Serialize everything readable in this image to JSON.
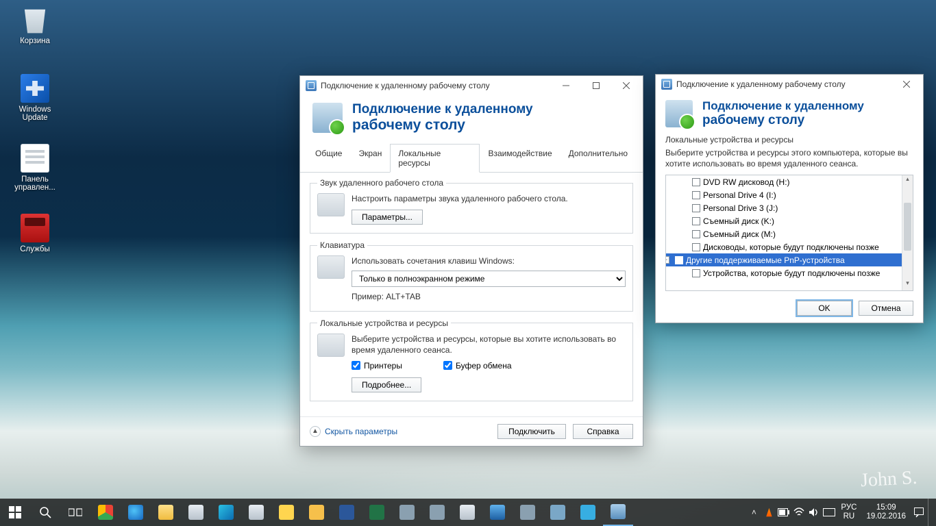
{
  "desktop_icons": {
    "recycle": "Корзина",
    "winupdate": "Windows Update",
    "panel": "Панель управлен...",
    "services": "Службы"
  },
  "win1": {
    "title": "Подключение к удаленному рабочему столу",
    "h1": "Подключение к удаленному",
    "h2": "рабочему столу",
    "tabs": [
      "Общие",
      "Экран",
      "Локальные ресурсы",
      "Взаимодействие",
      "Дополнительно"
    ],
    "fs_audio": {
      "legend": "Звук удаленного рабочего стола",
      "desc": "Настроить параметры звука удаленного рабочего стола.",
      "btn": "Параметры..."
    },
    "fs_kb": {
      "legend": "Клавиатура",
      "desc": "Использовать сочетания клавиш Windows:",
      "option": "Только в полноэкранном режиме",
      "example": "Пример: ALT+TAB"
    },
    "fs_local": {
      "legend": "Локальные устройства и ресурсы",
      "desc": "Выберите устройства и ресурсы, которые вы хотите использовать во время удаленного сеанса.",
      "cb1": "Принтеры",
      "cb2": "Буфер обмена",
      "btn": "Подробнее..."
    },
    "hide_params": "Скрыть параметры",
    "connect": "Подключить",
    "help": "Справка"
  },
  "win2": {
    "title": "Подключение к удаленному рабочему столу",
    "h1": "Подключение к удаленному",
    "h2": "рабочему столу",
    "section": "Локальные устройства и ресурсы",
    "desc": "Выберите устройства и ресурсы этого компьютера, которые вы хотите использовать во время удаленного сеанса.",
    "tree": [
      "DVD RW дисковод (H:)",
      "Personal Drive 4 (I:)",
      "Personal Drive 3 (J:)",
      "Съемный диск (K:)",
      "Съемный диск (M:)",
      "Дисководы, которые будут подключены позже",
      "Другие поддерживаемые PnP-устройства",
      "Устройства, которые будут подключены позже"
    ],
    "ok": "OK",
    "cancel": "Отмена"
  },
  "tray": {
    "lang1": "РУС",
    "lang2": "RU",
    "time": "15:09",
    "date": "19.02.2016"
  }
}
